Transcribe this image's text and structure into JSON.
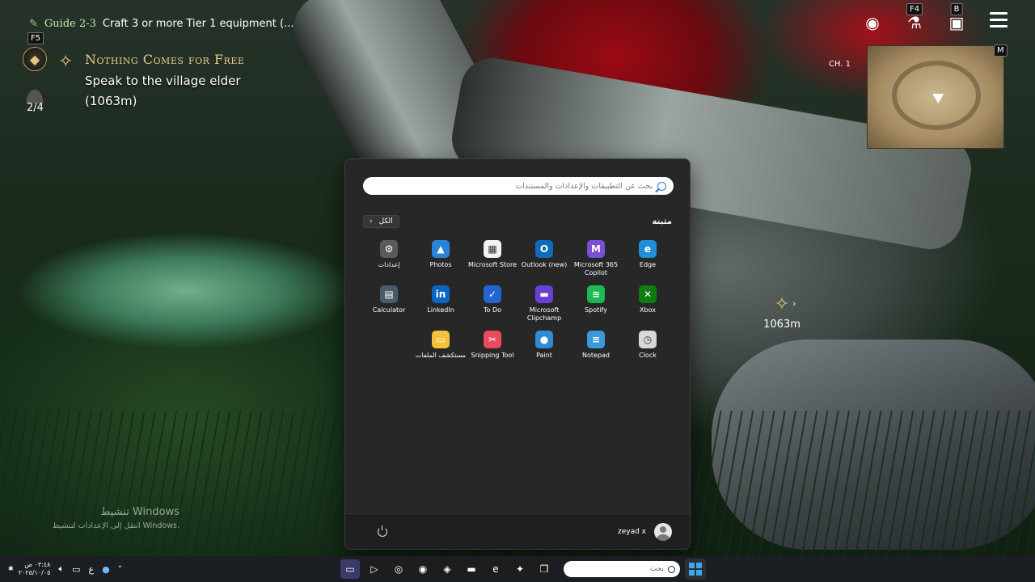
{
  "hud": {
    "guide_id": "Guide 2-3",
    "guide_task": "Craft 3 or more Tier 1 equipment (...",
    "quest_key": "F5",
    "quest_title": "Nothing Comes for Free",
    "quest_objective": "Speak to the village elder",
    "quest_distance": "(1063m)",
    "party_count": "2/4",
    "top_right": {
      "f4_key": "F4",
      "b_key": "B"
    },
    "chapter": "CH. 1",
    "minimap_key": "M",
    "marker_distance": "1063m"
  },
  "activation": {
    "title": "تنشيط Windows",
    "subtitle": "انتقل إلى الإعدادات لتنشيط Windows."
  },
  "start_menu": {
    "search_placeholder": "بحث عن التطبيقات والإعدادات والمستندات",
    "pinned_label": "مثبتة",
    "all_label": "الكل",
    "apps": [
      {
        "label": "Edge",
        "icon": "edge-icon",
        "color": "#1f8fd8",
        "glyph": "e"
      },
      {
        "label": "Microsoft 365 Copilot",
        "icon": "m365-copilot-icon",
        "color": "#7b4fd6",
        "glyph": "M"
      },
      {
        "label": "Outlook (new)",
        "icon": "outlook-icon",
        "color": "#0f6cbd",
        "glyph": "O"
      },
      {
        "label": "Microsoft Store",
        "icon": "store-icon",
        "color": "#f2f2f2",
        "glyph": "▦"
      },
      {
        "label": "Photos",
        "icon": "photos-icon",
        "color": "#2b82d9",
        "glyph": "▲"
      },
      {
        "label": "إعدادات",
        "icon": "settings-icon",
        "color": "#5a5a5a",
        "glyph": "⚙"
      },
      {
        "label": "Xbox",
        "icon": "xbox-icon",
        "color": "#107c10",
        "glyph": "✕"
      },
      {
        "label": "Spotify",
        "icon": "spotify-icon",
        "color": "#1db954",
        "glyph": "≋"
      },
      {
        "label": "Microsoft Clipchamp",
        "icon": "clipchamp-icon",
        "color": "#6b3fd4",
        "glyph": "▬"
      },
      {
        "label": "To Do",
        "icon": "todo-icon",
        "color": "#2564cf",
        "glyph": "✓"
      },
      {
        "label": "LinkedIn",
        "icon": "linkedin-icon",
        "color": "#0a66c2",
        "glyph": "in"
      },
      {
        "label": "Calculator",
        "icon": "calculator-icon",
        "color": "#4a5a6a",
        "glyph": "▤"
      },
      {
        "label": "Clock",
        "icon": "clock-icon",
        "color": "#d8d8d8",
        "glyph": "◷"
      },
      {
        "label": "Notepad",
        "icon": "notepad-icon",
        "color": "#3a9ad9",
        "glyph": "≡"
      },
      {
        "label": "Paint",
        "icon": "paint-icon",
        "color": "#2e8bd6",
        "glyph": "●"
      },
      {
        "label": "Snipping Tool",
        "icon": "snipping-tool-icon",
        "color": "#e84a5f",
        "glyph": "✂"
      },
      {
        "label": "مستكشف الملفات",
        "icon": "file-explorer-icon",
        "color": "#f3c13a",
        "glyph": "▭"
      }
    ],
    "user_name": "zeyad x"
  },
  "taskbar": {
    "time": "٠٣:٤٨ ص",
    "date": "٢٠٢٥/١٠/٠٥",
    "lang": "ع",
    "search_placeholder": "بحث",
    "apps": [
      {
        "icon": "taskbar-app-1-icon",
        "color": "#3b3b6a",
        "glyph": "▭"
      },
      {
        "icon": "nvidia-icon",
        "color": "#1d1d1d",
        "glyph": "▷"
      },
      {
        "icon": "xbox-app-icon",
        "color": "#1d1d1d",
        "glyph": "◎"
      },
      {
        "icon": "steam-icon",
        "color": "#1d1d1d",
        "glyph": "◉"
      },
      {
        "icon": "discord-icon",
        "color": "#1d1d1d",
        "glyph": "◈"
      },
      {
        "icon": "file-explorer-taskbar-icon",
        "color": "#1d1d1d",
        "glyph": "▬"
      },
      {
        "icon": "edge-taskbar-icon",
        "color": "#1d1d1d",
        "glyph": "e"
      },
      {
        "icon": "copilot-icon",
        "color": "#1d1d1d",
        "glyph": "✦"
      },
      {
        "icon": "task-view-icon",
        "color": "#1d1d1d",
        "glyph": "❐"
      }
    ]
  }
}
